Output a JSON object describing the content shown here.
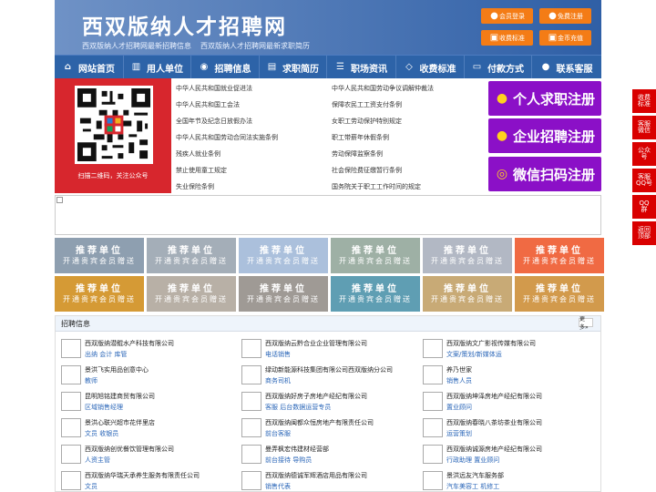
{
  "site": {
    "title": "西双版纳人才招聘网",
    "tagline_1": "西双版纳人才招聘网最新招聘信息",
    "tagline_2": "西双版纳人才招聘网最新求职简历"
  },
  "header_buttons": [
    "会员登录",
    "免费注册",
    "收费标准",
    "金币充值"
  ],
  "nav": [
    {
      "label": "网站首页",
      "icon": "home-icon"
    },
    {
      "label": "用人单位",
      "icon": "building-icon"
    },
    {
      "label": "招聘信息",
      "icon": "megaphone-icon"
    },
    {
      "label": "求职简历",
      "icon": "document-icon"
    },
    {
      "label": "职场资讯",
      "icon": "news-icon"
    },
    {
      "label": "收费标准",
      "icon": "price-icon"
    },
    {
      "label": "付款方式",
      "icon": "payment-icon"
    },
    {
      "label": "联系客服",
      "icon": "support-icon"
    }
  ],
  "qr": {
    "caption": "扫描二维码，关注公众号"
  },
  "policy_links": [
    "中华人民共和国就业促进法",
    "中华人民共和国劳动争议调解仲裁法",
    "中华人民共和国工会法",
    "保障农民工工资支付条例",
    "全国年节及纪念日放假办法",
    "女职工劳动保护特别规定",
    "中华人民共和国劳动合同法实施条例",
    "职工带薪年休假条例",
    "残疾人就业条例",
    "劳动保障监察条例",
    "禁止使用童工规定",
    "社会保险费征缴暂行条例",
    "失业保险条例",
    "国务院关于职工工作时间的规定"
  ],
  "registration_buttons": [
    "个人求职注册",
    "企业招聘注册",
    "微信扫码注册"
  ],
  "recommend": {
    "title": "推荐单位",
    "subtitle": "开通贵宾会员赠送"
  },
  "jobs": {
    "title": "招聘信息",
    "more": "更多»",
    "items": [
      {
        "company": "西双版纳潜鲲水产科技有限公司",
        "positions": "出纳 会计 库管"
      },
      {
        "company": "西双版纳云黔合业企业管理有限公司",
        "positions": "电话销售"
      },
      {
        "company": "西双版纳文广影视传媒有限公司",
        "positions": "文案/策划/新媒体运"
      },
      {
        "company": "景洪飞实用品创意中心",
        "positions": "教师"
      },
      {
        "company": "绿动新能源科技集团有限公司西双版纳分公司",
        "positions": "商务司机"
      },
      {
        "company": "养乃世家",
        "positions": "销售人员"
      },
      {
        "company": "昆明旭铭建商贸有限公司",
        "positions": "区域销售经理"
      },
      {
        "company": "西双版纳好房子房地产经纪有限公司",
        "positions": "客服 后台数据运营专员"
      },
      {
        "company": "西双版纳坤泽房地产经纪有限公司",
        "positions": "置业顾问"
      },
      {
        "company": "景洪心联兴超市花伴里店",
        "positions": "文员 收银员"
      },
      {
        "company": "西双版纳闽都众恒房地产有限责任公司",
        "positions": "前台客服"
      },
      {
        "company": "西双版纳春晓八茶坊茶业有限公司",
        "positions": "运营策划"
      },
      {
        "company": "西双版纳创优餐饮管理有限公司",
        "positions": "人资主管"
      },
      {
        "company": "曼弄枫宏伟建材经营部",
        "positions": "前台接待 导购员"
      },
      {
        "company": "西双版纳诚源房地产经纪有限公司",
        "positions": "行政助理 置业顾问"
      },
      {
        "company": "西双版纳华瑞天承养生服务有限责任公司",
        "positions": "文员"
      },
      {
        "company": "西双版纳德诚军辉酒店用品有限公司",
        "positions": "销售代表"
      },
      {
        "company": "景洪远友汽车服务部",
        "positions": "汽车美容工 机修工"
      }
    ]
  },
  "side_buttons": [
    "收费\n标准",
    "客服\n微信",
    "公众\n号",
    "客服\nQQ号",
    "QQ\n群",
    "返回\n顶部"
  ],
  "colors": {
    "nav": "#2d63a8",
    "orange": "#f47c16",
    "purple": "#8b10c7",
    "red": "#d90000",
    "tiles": [
      "#8e9fb0",
      "#a4aeb8",
      "#abc0dc",
      "#9eb0a5",
      "#b2b8c4",
      "#f06a43",
      "#d59a35",
      "#b8b0a6",
      "#9f9a95",
      "#5f9eb3",
      "#c8aa76",
      "#d29a4c"
    ]
  }
}
